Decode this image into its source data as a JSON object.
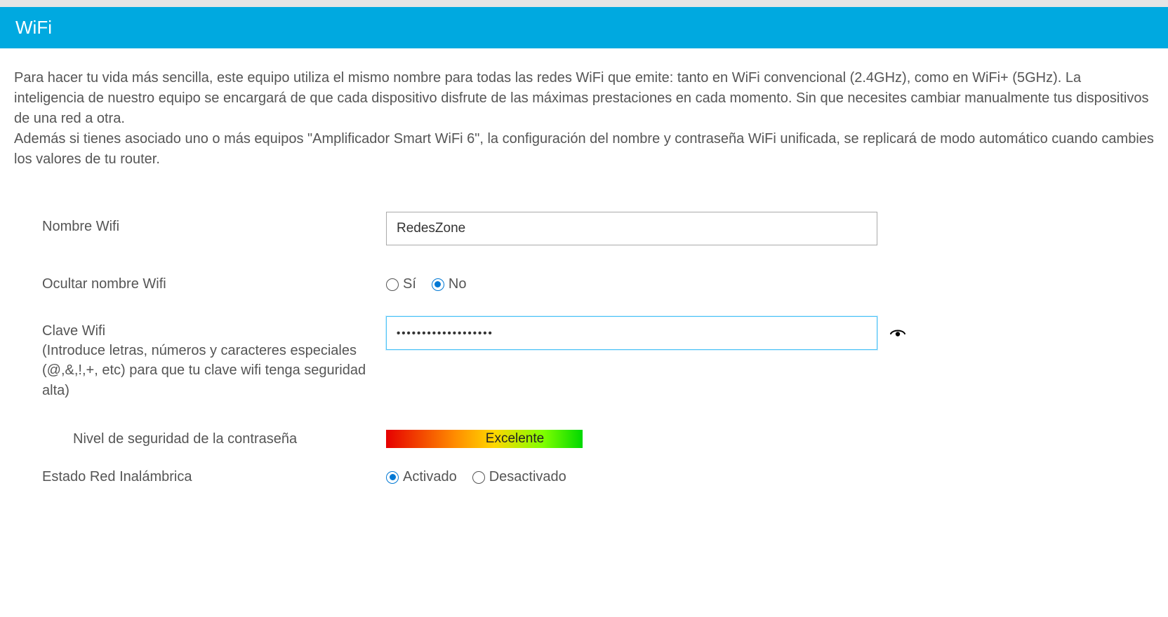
{
  "header": {
    "title": "WiFi"
  },
  "intro": {
    "p1": "Para hacer tu vida más sencilla, este equipo utiliza el mismo nombre para todas las redes WiFi que emite: tanto en WiFi convencional (2.4GHz), como en WiFi+ (5GHz). La inteligencia de nuestro equipo se encargará de que cada dispositivo disfrute de las máximas prestaciones en cada momento. Sin que necesites cambiar manualmente tus dispositivos de una red a otra.",
    "p2": "Además si tienes asociado uno o más equipos \"Amplificador Smart WiFi 6\", la configuración del nombre y contraseña WiFi unificada, se replicará de modo automático cuando cambies los valores de tu router."
  },
  "fields": {
    "wifi_name": {
      "label": "Nombre Wifi",
      "value": "RedesZone"
    },
    "hide_ssid": {
      "label": "Ocultar nombre Wifi",
      "option_yes": "Sí",
      "option_no": "No"
    },
    "wifi_key": {
      "label": "Clave Wifi",
      "hint": "(Introduce letras, números y caracteres especiales (@,&,!,+, etc) para que tu clave wifi tenga seguridad alta)",
      "value": "•••••••••••••••••••"
    },
    "strength": {
      "label": "Nivel de seguridad de la contraseña",
      "value": "Excelente"
    },
    "wifi_state": {
      "label": "Estado Red Inalámbrica",
      "option_on": "Activado",
      "option_off": "Desactivado"
    }
  }
}
